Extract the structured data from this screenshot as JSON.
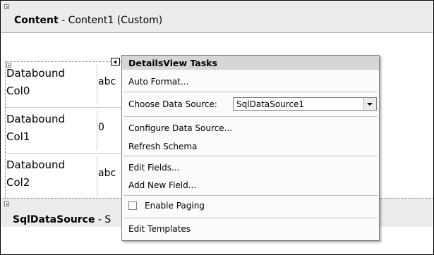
{
  "content_region": {
    "title_bold": "Content",
    "title_rest": " - Content1 (Custom)"
  },
  "details_view": {
    "rows": [
      {
        "name_line1": "Databound",
        "name_line2": "Col0",
        "value": "abc"
      },
      {
        "name_line1": "Databound",
        "name_line2": "Col1",
        "value": "0"
      },
      {
        "name_line1": "Databound",
        "name_line2": "Col2",
        "value": "abc"
      }
    ]
  },
  "sql_region": {
    "title_bold": "SqlDataSource",
    "title_rest": " - S"
  },
  "tasks_panel": {
    "title": "DetailsView Tasks",
    "auto_format": "Auto Format...",
    "choose_data_source_label": "Choose Data Source:",
    "data_source_value": "SqlDataSource1",
    "configure_data_source": "Configure Data Source...",
    "refresh_schema": "Refresh Schema",
    "edit_fields": "Edit Fields...",
    "add_new_field": "Add New Field...",
    "enable_paging": "Enable Paging",
    "edit_templates": "Edit Templates"
  }
}
